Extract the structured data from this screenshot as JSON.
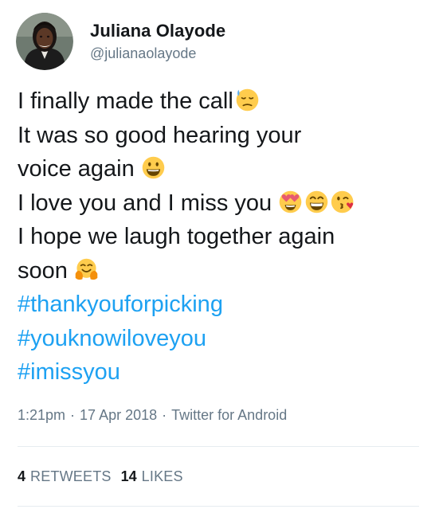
{
  "user": {
    "display_name": "Juliana Olayode",
    "handle": "@julianaolayode"
  },
  "tweet": {
    "lines": [
      {
        "text": "I finally made the call",
        "emojis": [
          "downcast-sweat-emoji"
        ]
      },
      {
        "text": "It was so good hearing your",
        "emojis": []
      },
      {
        "text": "voice again ",
        "emojis": [
          "grinning-face-emoji"
        ]
      },
      {
        "text": "I love you and I miss you ",
        "emojis": [
          "heart-eyes-emoji",
          "grinning-squint-emoji",
          "kissing-heart-emoji"
        ]
      },
      {
        "text": "I hope we laugh together again",
        "emojis": []
      },
      {
        "text": "soon ",
        "emojis": [
          "hugging-face-emoji"
        ]
      }
    ],
    "hashtags": [
      "#thankyouforpicking",
      "#youknowiloveyou",
      "#imissyou"
    ]
  },
  "meta": {
    "time": "1:21pm",
    "separator": "·",
    "date": "17 Apr 2018",
    "source": "Twitter for Android"
  },
  "stats": {
    "retweets_count": "4",
    "retweets_label": "RETWEETS",
    "likes_count": "14",
    "likes_label": "LIKES"
  },
  "colors": {
    "text": "#14171a",
    "secondary": "#657786",
    "hashtag": "#1da1f2",
    "divider": "#e6ecf0"
  }
}
